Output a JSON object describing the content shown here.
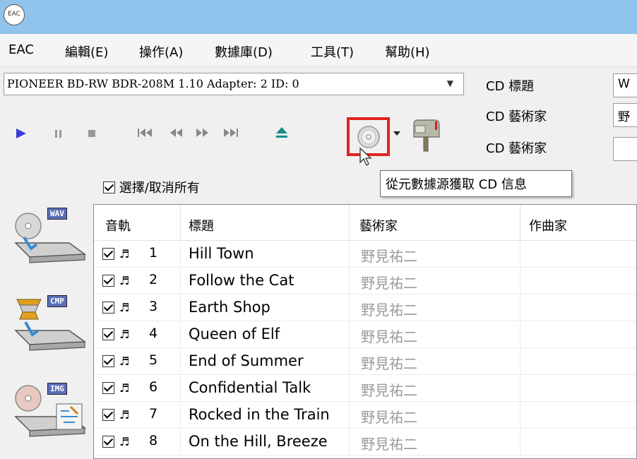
{
  "app": {
    "icon_text": "EAC"
  },
  "menu": [
    "EAC",
    "編輯(E)",
    "操作(A)",
    "數據庫(D)",
    "工具(T)",
    "幫助(H)"
  ],
  "drive": {
    "selected": "PIONEER BD-RW   BDR-208M 1.10  Adapter: 2  ID: 0"
  },
  "cd_info": {
    "title_label": "CD 標題",
    "artist_label": "CD 藝術家",
    "artist2_label": "CD 藝術家",
    "title_value": "W",
    "artist_value": "野"
  },
  "tooltip": "從元數據源獲取 CD 信息",
  "select_all_label": "選擇/取消所有",
  "side_tags": {
    "wav": "WAV",
    "cmp": "CMP",
    "img": "IMG"
  },
  "columns": {
    "track": "音軌",
    "title": "標題",
    "artist": "藝術家",
    "composer": "作曲家"
  },
  "tracks": [
    {
      "num": "1",
      "title": "Hill Town",
      "artist": "野見祐二"
    },
    {
      "num": "2",
      "title": "Follow the Cat",
      "artist": "野見祐二"
    },
    {
      "num": "3",
      "title": "Earth Shop",
      "artist": "野見祐二"
    },
    {
      "num": "4",
      "title": "Queen of Elf",
      "artist": "野見祐二"
    },
    {
      "num": "5",
      "title": "End of Summer",
      "artist": "野見祐二"
    },
    {
      "num": "6",
      "title": "Confidential Talk",
      "artist": "野見祐二"
    },
    {
      "num": "7",
      "title": "Rocked in the Train",
      "artist": "野見祐二"
    },
    {
      "num": "8",
      "title": "On the Hill, Breeze",
      "artist": "野見祐二"
    }
  ],
  "colors": {
    "titlebar": "#90c4ec",
    "highlight": "#e32320",
    "play": "#3b3bd8",
    "eject": "#1a8a8a"
  }
}
